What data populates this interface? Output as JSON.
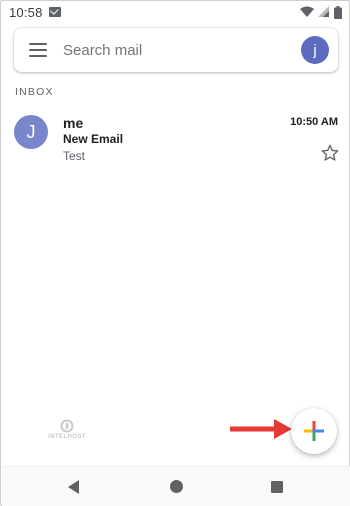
{
  "status_bar": {
    "time": "10:58",
    "notification_icon": "gmail-icon",
    "icons": [
      "wifi-icon",
      "signal-icon",
      "battery-icon"
    ]
  },
  "search": {
    "placeholder": "Search mail",
    "menu_icon": "hamburger-menu-icon",
    "account_initial": "j"
  },
  "inbox": {
    "label": "INBOX",
    "messages": [
      {
        "avatar_initial": "J",
        "sender": "me",
        "subject": "New Email",
        "snippet": "Test",
        "time": "10:50 AM",
        "starred": false
      }
    ]
  },
  "watermark": {
    "text": "INTELHOST"
  },
  "compose": {
    "icon": "compose-plus-icon"
  },
  "annotation": {
    "icon": "red-arrow-icon",
    "color": "#e53935"
  },
  "nav": {
    "icons": [
      "back-icon",
      "home-icon",
      "recents-icon"
    ]
  },
  "colors": {
    "account_avatar": "#5c6bc0",
    "sender_avatar": "#7986cb",
    "plus_blue": "#4285f4",
    "plus_red": "#ea4335",
    "plus_yellow": "#fbbc05",
    "plus_green": "#34a853"
  }
}
